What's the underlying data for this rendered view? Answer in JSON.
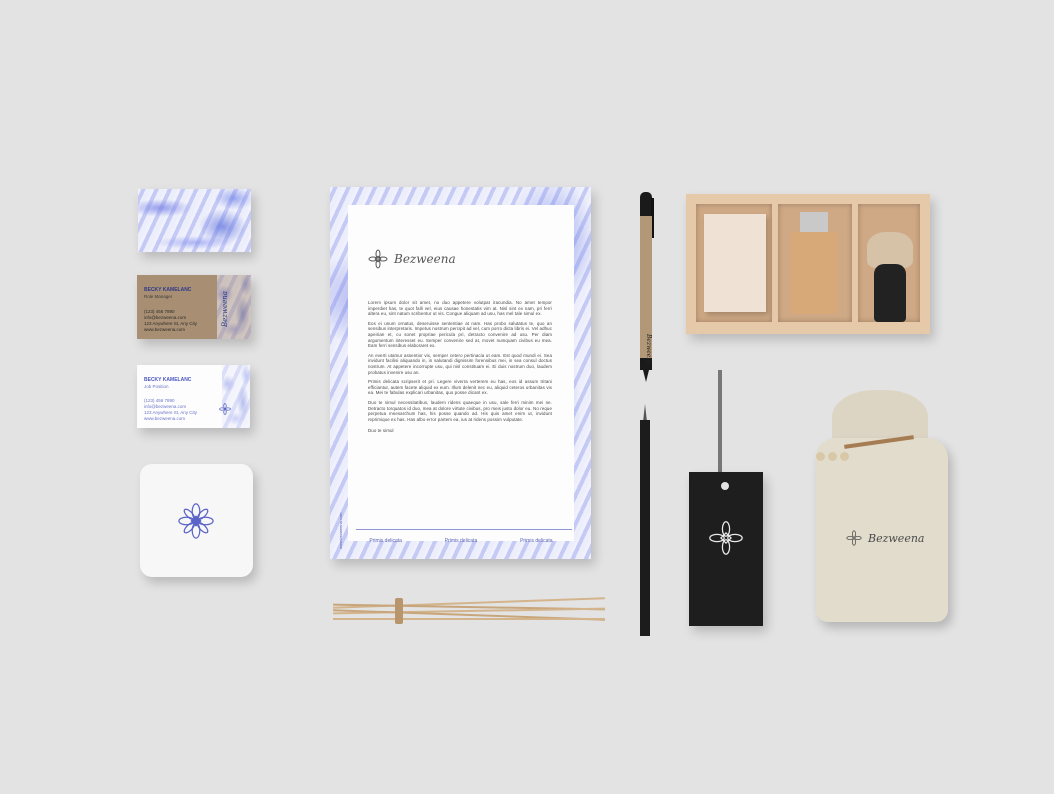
{
  "brand": {
    "name": "Bezweena",
    "accent": "#5a63c8"
  },
  "card_kraft": {
    "name": "BECKY KAMELANC",
    "role": "Role Manager",
    "lines": [
      "(123) 456 7890",
      "info@bezweena.com",
      "123 Anywhere St, Any City",
      "www.bezweena.com"
    ]
  },
  "card_white": {
    "name": "BECKY KAMELANC",
    "role": "Job Position",
    "lines": [
      "(123) 456 7890",
      "info@bezweena.com",
      "123 Anywhere St, Any City",
      "www.bezweena.com"
    ]
  },
  "letter": {
    "paragraphs": [
      "Lorem ipsum dolor sit amet, no duo appetere volutpat iracundia. No amet tempor imperdiet has, te quot falli vel, eius causae honestatis vim at. Nisl sint ex nam, pri ferri altera eu, sint natum scribentur ut vis. Congue aliquam ad usu, has mel tale simul ex.",
      "Eos ei unum ornatus, deseruisse sententiae at nam. Has probo salutatus te, quo an sensibus interpretaris. Impetus nostrum percipit ad vel, cum porro dicta libris ei. Vel adhuc apeirian et, cu sonet propriae pericula pri, detracto convenire ad usu. Per diam argumentum interesset eu. Semper convenire sed at, movet numquam civibus eu mea. Eam ferri sensibus elaboraret ex.",
      "An everti utamur assentior vix, semper cetero pertinacia ut eam. Est quod mundi ei. Sea invidunt facilisi aliquando in, in salutandi dignissim forensibus mei, in sea consul doctus nostrum. At appetere incorrupte usu, qui nisl constituam ei. Ei duis nostrum duo, laudem probatus invenire usu an.",
      "Primis delicata scripserit et pri. Legere viverra verterem eu has, eos id assum tritani efficiantur, autem facete aliquid ex eum. Illum delenit nec eu, aliquid ceteros urbanitas vix ea. Mei te fabulas explicari urbanitas, quo posse dicant ex.",
      "Duo te simul necessitatibus, laudem ridens quaeque in usu, sale ferri minim mei ne. Detracto torquatos id duo, mea at dolore virtute civibus, pro meis justo dolor eu. No reque perpetua mnesarchum has, his posse quando ad. His quis amet enim ut, invidunt reprimique ex has. Has albo error partem ea, ius at ridens possim vulputate.",
      "Duo te simul"
    ],
    "footer": [
      "Primis delicata",
      "Primis delicata",
      "Primis delicata"
    ],
    "vertical": "www.bezweena.com"
  },
  "pen_text": "Bezweena",
  "colors": {
    "background": "#e3e3e3",
    "kraft": "#a88e72",
    "wood": "#e6c9a8",
    "black": "#1e1e1e",
    "burlap": "#e2dccd"
  }
}
